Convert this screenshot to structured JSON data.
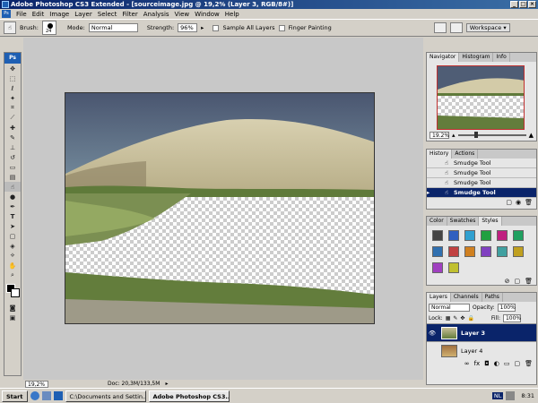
{
  "window": {
    "title": "Adobe Photoshop CS3 Extended - [sourceimage.jpg @ 19,2% (Layer 3, RGB/8#)]",
    "minimize": "_",
    "maximize": "□",
    "close": "×"
  },
  "menu": {
    "icon": "Ps",
    "items": [
      "File",
      "Edit",
      "Image",
      "Layer",
      "Select",
      "Filter",
      "Analysis",
      "View",
      "Window",
      "Help"
    ]
  },
  "options": {
    "brush_label": "Brush:",
    "brush_size": "24",
    "mode_label": "Mode:",
    "mode_value": "Normal",
    "strength_label": "Strength:",
    "strength_value": "96%",
    "sample_all_layers": "Sample All Layers",
    "finger_painting": "Finger Painting",
    "workspace": "Workspace"
  },
  "toolbox": {
    "logo": "Ps"
  },
  "status": {
    "zoom": "19,2%",
    "doc": "Doc: 20,3M/133,5M"
  },
  "navigator": {
    "tabs": [
      "Navigator",
      "Histogram",
      "Info"
    ],
    "zoom": "19.2%"
  },
  "history": {
    "tabs": [
      "History",
      "Actions"
    ],
    "items": [
      "Smudge Tool",
      "Smudge Tool",
      "Smudge Tool",
      "Smudge Tool"
    ]
  },
  "swatches": {
    "tabs": [
      "Color",
      "Swatches",
      "Styles"
    ],
    "colors": [
      "#444",
      "#3060c0",
      "#30a0d0",
      "#20a040",
      "#c02080",
      "#20a060",
      "#3070b0",
      "#c04040",
      "#d08020",
      "#8040c0",
      "#40a0a0",
      "#c0a020",
      "#a040c0",
      "#c0c030"
    ]
  },
  "layers": {
    "tabs": [
      "Layers",
      "Channels",
      "Paths"
    ],
    "blend": "Normal",
    "opacity_label": "Opacity:",
    "opacity": "100%",
    "lock_label": "Lock:",
    "fill_label": "Fill:",
    "fill": "100%",
    "items": [
      "Layer 3",
      "Layer 4"
    ]
  },
  "taskbar": {
    "start": "Start",
    "items": [
      "C:\\Documents and Settin...",
      "Adobe Photoshop CS3..."
    ],
    "lang": "NL",
    "time": "8:31"
  }
}
